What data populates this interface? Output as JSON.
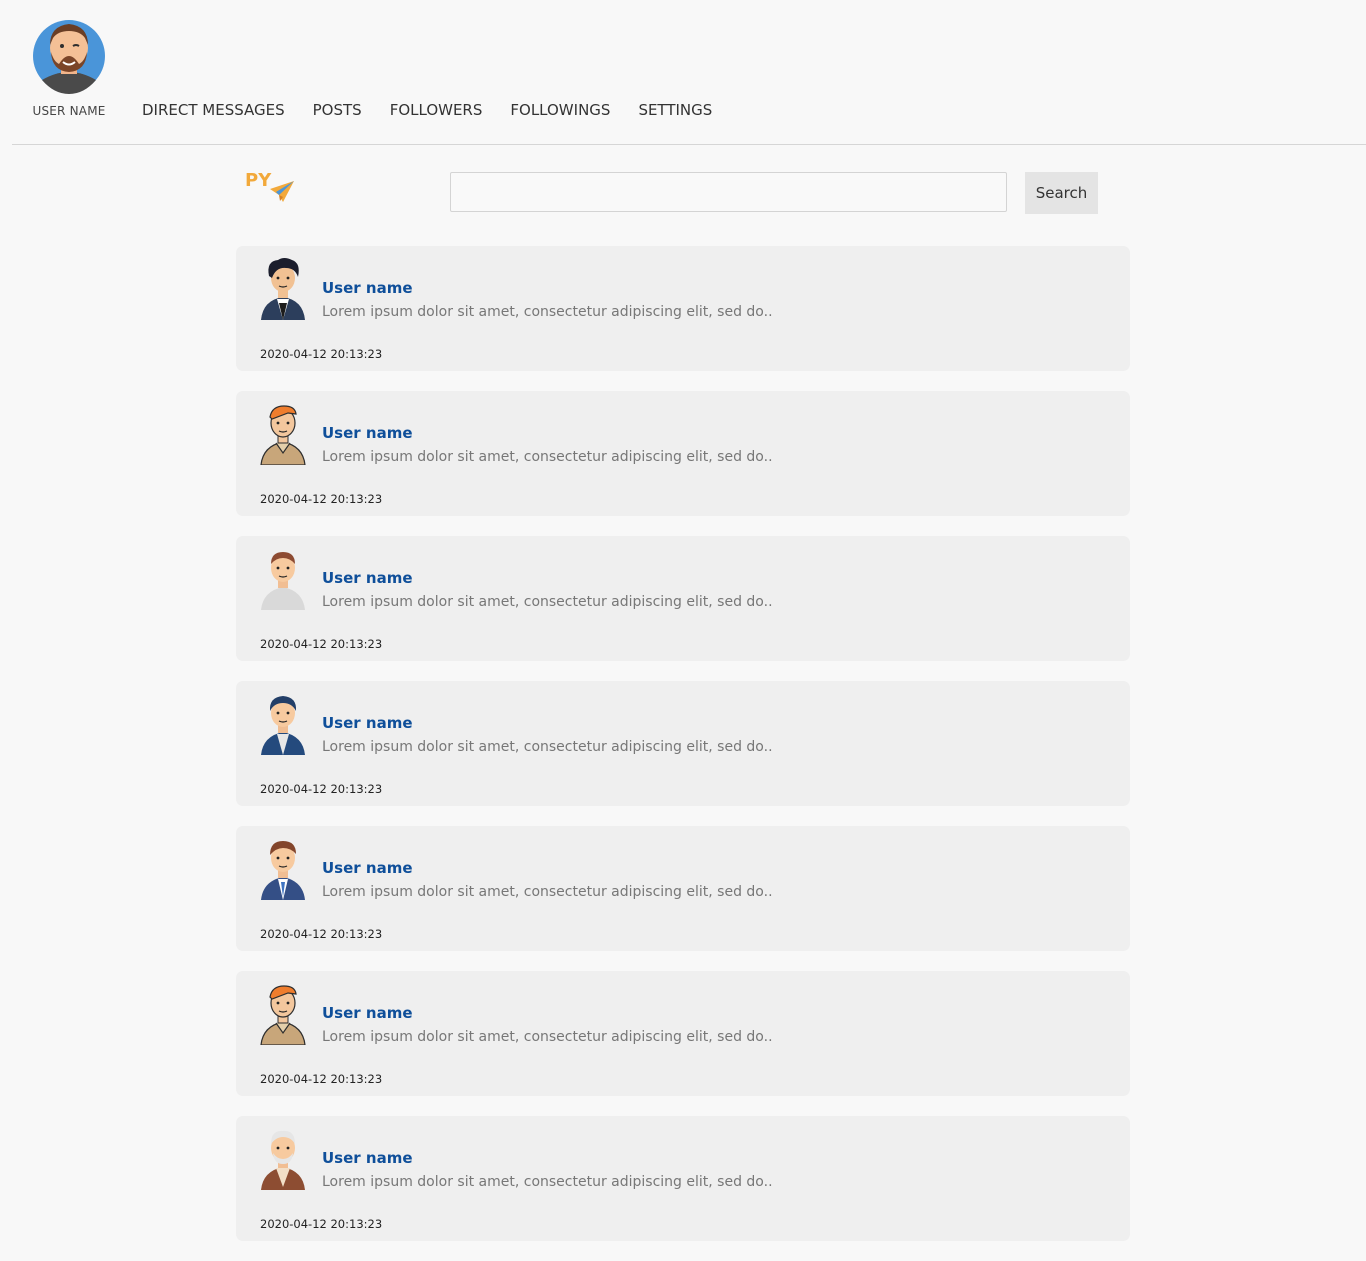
{
  "profile": {
    "name": "USER NAME",
    "avatar_icon": "bearded-man-avatar-icon"
  },
  "nav": {
    "items": [
      {
        "label": "DIRECT MESSAGES"
      },
      {
        "label": "POSTS"
      },
      {
        "label": "FOLLOWERS"
      },
      {
        "label": "FOLLOWINGS"
      },
      {
        "label": "SETTINGS"
      }
    ]
  },
  "brand": {
    "text": "PY",
    "icon": "paper-plane-icon",
    "color": "#f2a93b"
  },
  "search": {
    "value": "",
    "placeholder": "",
    "button_label": "Search"
  },
  "colors": {
    "username": "#0f4f9a",
    "card_background": "#efefef",
    "page_background": "#f8f8f8"
  },
  "posts": [
    {
      "username": "User name",
      "text": "Lorem ipsum dolor sit amet, consectetur adipiscing elit, sed do..",
      "timestamp": "2020-04-12 20:13:23",
      "avatar_icon": "curly-hair-man-avatar-icon"
    },
    {
      "username": "User name",
      "text": "Lorem ipsum dolor sit amet, consectetur adipiscing elit, sed do..",
      "timestamp": "2020-04-12 20:13:23",
      "avatar_icon": "orange-hair-man-avatar-icon"
    },
    {
      "username": "User name",
      "text": "Lorem ipsum dolor sit amet, consectetur adipiscing elit, sed do..",
      "timestamp": "2020-04-12 20:13:23",
      "avatar_icon": "casual-man-avatar-icon"
    },
    {
      "username": "User name",
      "text": "Lorem ipsum dolor sit amet, consectetur adipiscing elit, sed do..",
      "timestamp": "2020-04-12 20:13:23",
      "avatar_icon": "business-man-avatar-icon"
    },
    {
      "username": "User name",
      "text": "Lorem ipsum dolor sit amet, consectetur adipiscing elit, sed do..",
      "timestamp": "2020-04-12 20:13:23",
      "avatar_icon": "suit-man-avatar-icon"
    },
    {
      "username": "User name",
      "text": "Lorem ipsum dolor sit amet, consectetur adipiscing elit, sed do..",
      "timestamp": "2020-04-12 20:13:23",
      "avatar_icon": "orange-hair-man-avatar-icon"
    },
    {
      "username": "User name",
      "text": "Lorem ipsum dolor sit amet, consectetur adipiscing elit, sed do..",
      "timestamp": "2020-04-12 20:13:23",
      "avatar_icon": "old-man-avatar-icon"
    }
  ]
}
